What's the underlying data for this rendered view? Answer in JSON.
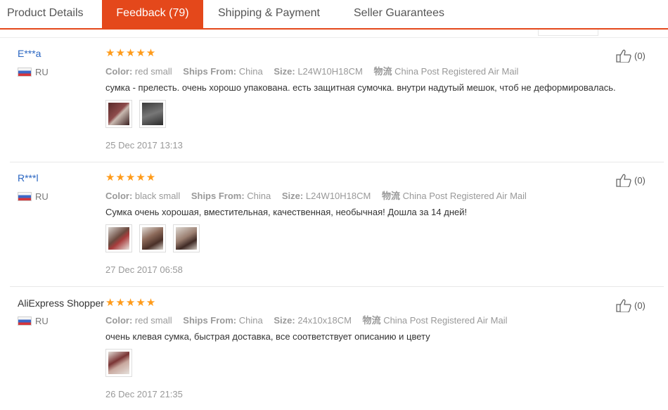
{
  "tabs": [
    {
      "label": "Product Details",
      "active": false
    },
    {
      "label": "Feedback (79)",
      "active": true
    },
    {
      "label": "Shipping & Payment",
      "active": false
    },
    {
      "label": "Seller Guarantees",
      "active": false
    }
  ],
  "labels": {
    "color": "Color:",
    "ships_from": "Ships From:",
    "size": "Size:",
    "logistics": "物流"
  },
  "reviews": [
    {
      "user": "E***a",
      "country": "RU",
      "rating": 5,
      "color": "red small",
      "ships_from": "China",
      "size": "L24W10H18CM",
      "logistics": "China Post Registered Air Mail",
      "text": "сумка - прелесть. очень хорошо упакована. есть защитная сумочка. внутри надутый мешок, чтоб не деформировалась.",
      "photos": 2,
      "date": "25 Dec 2017 13:13",
      "likes": "(0)"
    },
    {
      "user": "R***l",
      "country": "RU",
      "rating": 5,
      "color": "black small",
      "ships_from": "China",
      "size": "L24W10H18CM",
      "logistics": "China Post Registered Air Mail",
      "text": "Сумка очень хорошая, вместительная, качественная, необычная! Дошла за 14 дней!",
      "photos": 3,
      "date": "27 Dec 2017 06:58",
      "likes": "(0)"
    },
    {
      "user": "AliExpress Shopper",
      "country": "RU",
      "rating": 5,
      "color": "red small",
      "ships_from": "China",
      "size": "24x10x18CM",
      "logistics": "China Post Registered Air Mail",
      "text": "очень клевая сумка, быстрая доставка, все соответствует описанию и цвету",
      "photos": 1,
      "date": "26 Dec 2017 21:35",
      "likes": "(0)"
    }
  ],
  "colors": {
    "accent": "#e4481b",
    "star": "#ff9b1a",
    "username": "#2a66c2"
  }
}
